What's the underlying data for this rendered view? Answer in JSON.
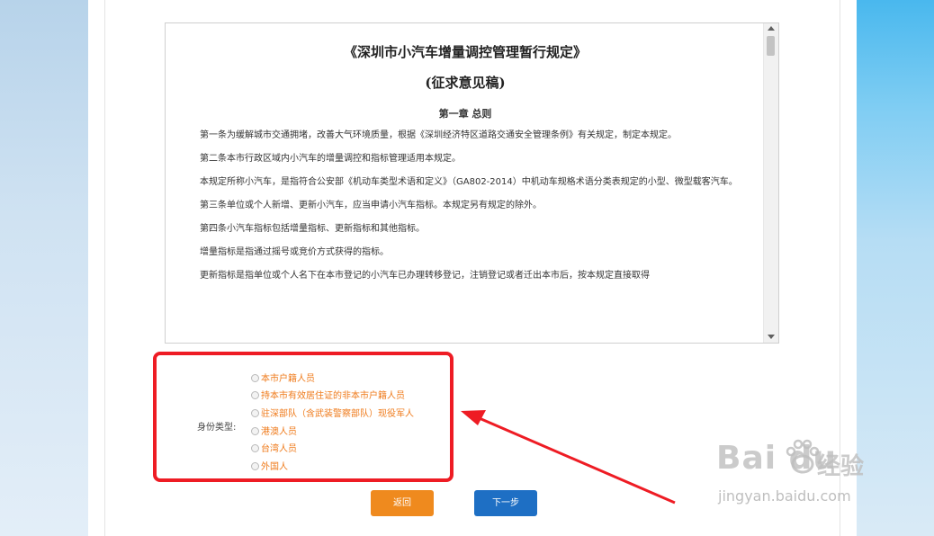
{
  "document": {
    "title": "《深圳市小汽车增量调控管理暂行规定》",
    "subtitle": "(征求意见稿)",
    "chapter": "第一章 总则",
    "paragraphs": [
      "第一条为缓解城市交通拥堵，改善大气环境质量，根据《深圳经济特区道路交通安全管理条例》有关规定，制定本规定。",
      "第二条本市行政区域内小汽车的增量调控和指标管理适用本规定。",
      "本规定所称小汽车，是指符合公安部《机动车类型术语和定义》（GA802-2014）中机动车规格术语分类表规定的小型、微型载客汽车。",
      "第三条单位或个人新增、更新小汽车，应当申请小汽车指标。本规定另有规定的除外。",
      "第四条小汽车指标包括增量指标、更新指标和其他指标。",
      "增量指标是指通过摇号或竞价方式获得的指标。",
      "更新指标是指单位或个人名下在本市登记的小汽车已办理转移登记，注销登记或者迁出本市后，按本规定直接取得"
    ]
  },
  "identity": {
    "label": "身份类型:",
    "options": [
      "本市户籍人员",
      "持本市有效居住证的非本市户籍人员",
      "驻深部队（含武装警察部队）现役军人",
      "港澳人员",
      "台湾人员",
      "外国人"
    ]
  },
  "buttons": {
    "back": "返回",
    "next": "下一步"
  },
  "watermark": {
    "brand": "Bai du",
    "brand_cn": "经验",
    "url": "jingyan.baidu.com"
  },
  "colors": {
    "highlight": "#ee1c24",
    "option_text": "#ef7a1a",
    "back_button": "#ef8a1e",
    "next_button": "#1e6fc4"
  }
}
